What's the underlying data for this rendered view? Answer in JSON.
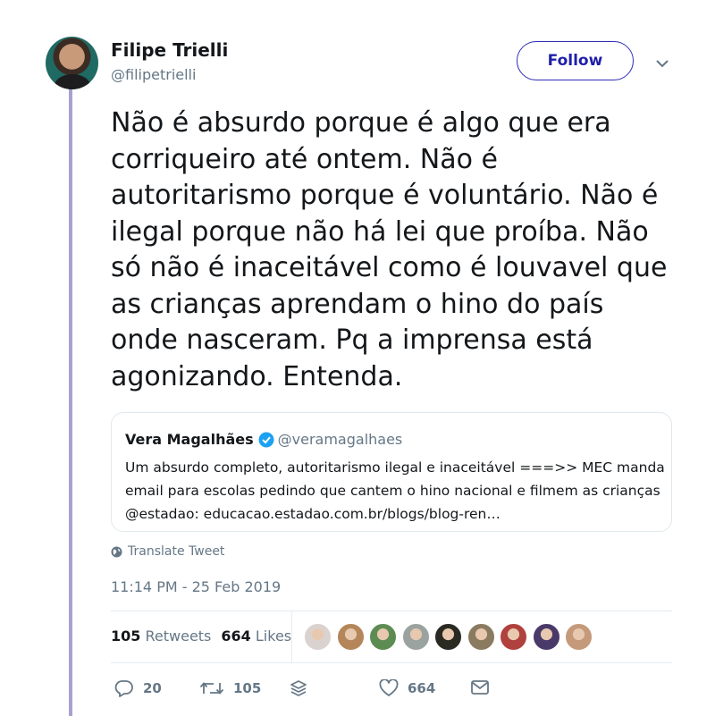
{
  "tweet": {
    "author": {
      "name": "Filipe Trielli",
      "handle": "@filipetrielli"
    },
    "follow_label": "Follow",
    "text_lines": [
      "Não é absurdo porque é algo que era",
      "corriqueiro até ontem. Não é",
      "autoritarismo porque é voluntário. Não é",
      "ilegal porque não há lei que proíba. Não",
      "só não é inaceitável como é louvavel que",
      "as crianças aprendam o hino do país",
      "onde nasceram. Pq a imprensa está",
      "agonizando. Entenda."
    ],
    "quoted": {
      "name": "Vera Magalhães",
      "handle": "@veramagalhaes",
      "text_lines": [
        "Um absurdo completo, autoritarismo ilegal e inaceitável ===>> MEC manda",
        "email para escolas pedindo que cantem o hino nacional e filmem as crianças",
        "@estadao:  educacao.estadao.com.br/blogs/blog-ren…"
      ]
    },
    "translate_label": "Translate Tweet",
    "timestamp": "11:14 PM - 25 Feb 2019",
    "stats": {
      "retweets_count": "105",
      "retweets_label": " Retweets",
      "likes_count": "664",
      "likes_label": " Likes"
    },
    "actions": {
      "replies": "20",
      "retweets": "105",
      "likes": "664"
    }
  },
  "colors": {
    "follow_border": "#2d2db8",
    "thread_line": "#a7a2cf",
    "verified": "#1da1f2",
    "muted_text": "#657786"
  },
  "likers": [
    {
      "name": "liker-1",
      "color": "#d9d2cf"
    },
    {
      "name": "liker-2",
      "color": "#b4865a"
    },
    {
      "name": "liker-3",
      "color": "#5d8c53"
    },
    {
      "name": "liker-4",
      "color": "#9aa3a0"
    },
    {
      "name": "liker-5",
      "color": "#2a2a22"
    },
    {
      "name": "liker-6",
      "color": "#8a7a60"
    },
    {
      "name": "liker-7",
      "color": "#b0413e"
    },
    {
      "name": "liker-8",
      "color": "#4a3a6a"
    },
    {
      "name": "liker-9",
      "color": "#c49a7a"
    }
  ]
}
